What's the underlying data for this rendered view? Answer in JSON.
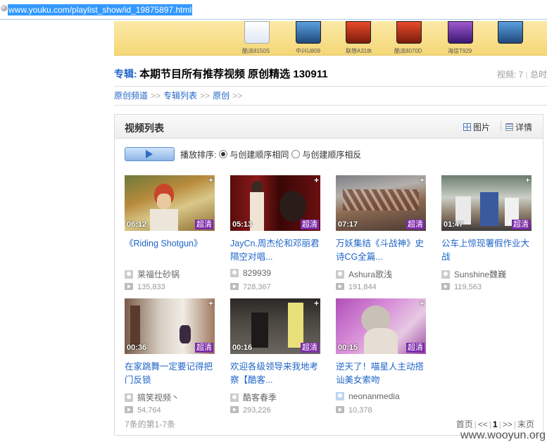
{
  "browser": {
    "url": "www.youku.com/playlist_show/id_19875897.html"
  },
  "banner": {
    "phones": [
      {
        "label": "酷派8150S"
      },
      {
        "label": "中兴U809"
      },
      {
        "label": "联想A318t"
      },
      {
        "label": "酷派8070D"
      },
      {
        "label": "海信T929"
      }
    ]
  },
  "header": {
    "label": "专辑:",
    "title": "本期节目所有推荐视频 原创精选 130911",
    "video_count": "视频: 7",
    "total_cut": "总时"
  },
  "breadcrumb": [
    "原创频道",
    "专辑列表",
    "原创"
  ],
  "breadcrumb_sep": ">>",
  "panel": {
    "title": "视频列表",
    "view_pic": "图片",
    "view_detail": "详情",
    "sort_label": "播放排序:",
    "sort_same": "与创建顺序相同",
    "sort_reverse": "与创建顺序相反"
  },
  "videos": [
    {
      "duration": "06:12",
      "hd": "超清",
      "title": "《Riding Shotgun》",
      "uploader": "莱福仕砂锅",
      "plays": "135,833"
    },
    {
      "duration": "05:13",
      "hd": "超清",
      "title": "JayCn.周杰伦和邓丽君隔空对唱...",
      "uploader": "829939",
      "plays": "728,367"
    },
    {
      "duration": "07:17",
      "hd": "超清",
      "title": "万妖集结《斗战神》史诗CG全篇...",
      "uploader": "Ashura歌浅",
      "plays": "191,844"
    },
    {
      "duration": "01:47",
      "hd": "超清",
      "title": "公车上惊现署假作业大战",
      "uploader": "Sunshine魏巍",
      "plays": "119,563"
    },
    {
      "duration": "00:36",
      "hd": "超清",
      "title": "在家跳舞一定要记得把门反锁",
      "uploader": "搞笑视频丶",
      "plays": "54,764"
    },
    {
      "duration": "00:16",
      "hd": "超清",
      "title": "欢迎各级领导来我地考察【酷客...",
      "uploader": "酷客春季",
      "plays": "293,226"
    },
    {
      "duration": "00:15",
      "hd": "超清",
      "title": "逆天了！喵星人主动搭讪美女索吻",
      "uploader": "neonanmedia",
      "plays": "10,378"
    }
  ],
  "footer": {
    "total": "7条的第1-7条",
    "first": "首页",
    "prev": "<<",
    "page": "1",
    "next": ">>",
    "last": "末页"
  },
  "watermark": "www.wooyun.org"
}
